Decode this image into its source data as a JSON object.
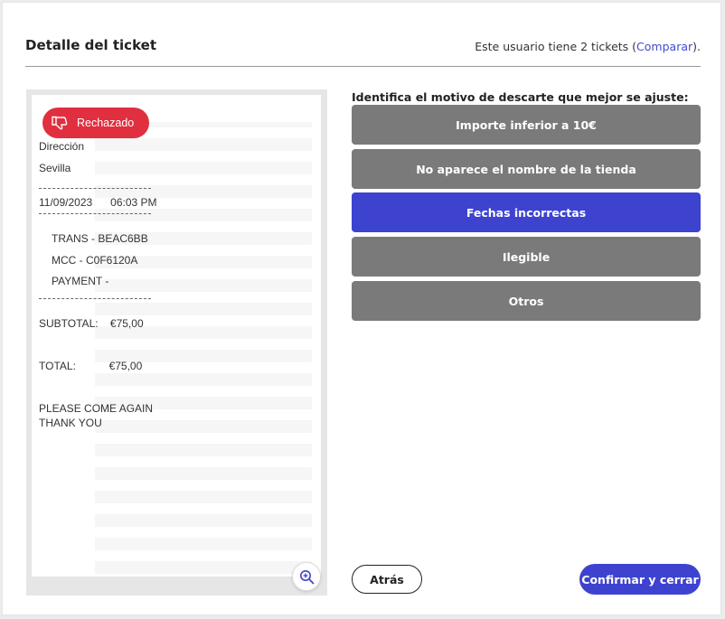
{
  "header": {
    "title": "Detalle del ticket",
    "count_prefix": "Este usuario tiene 2 tickets (",
    "compare_link": "Comparar",
    "count_suffix": ")."
  },
  "badge": {
    "label": "Rechazado",
    "icon": "thumbs-down-icon",
    "color": "#e02f3f"
  },
  "receipt": {
    "lines": [
      "Dirección",
      "Sevilla",
      "11/09/2023      06:03 PM",
      "TRANS - BEAC6BB",
      "MCC - C0F6120A",
      "PAYMENT -",
      "SUBTOTAL:    €75,00",
      "TOTAL:           €75,00",
      "PLEASE COME AGAIN",
      "THANK YOU"
    ]
  },
  "zoom": {
    "icon": "zoom-in-icon"
  },
  "discard": {
    "prompt": "Identifica el motivo de descarte que mejor se ajuste:",
    "options": [
      "Importe inferior a 10€",
      "No aparece el nombre de la tienda",
      "Fechas incorrectas",
      "Ilegible",
      "Otros"
    ],
    "selected": "Fechas incorrectas"
  },
  "actions": {
    "back_label": "Atrás",
    "confirm_label": "Confirmar y cerrar"
  },
  "colors": {
    "accent": "#3e43cf",
    "option_default": "#7a7a7a",
    "reject": "#e02f3f"
  }
}
